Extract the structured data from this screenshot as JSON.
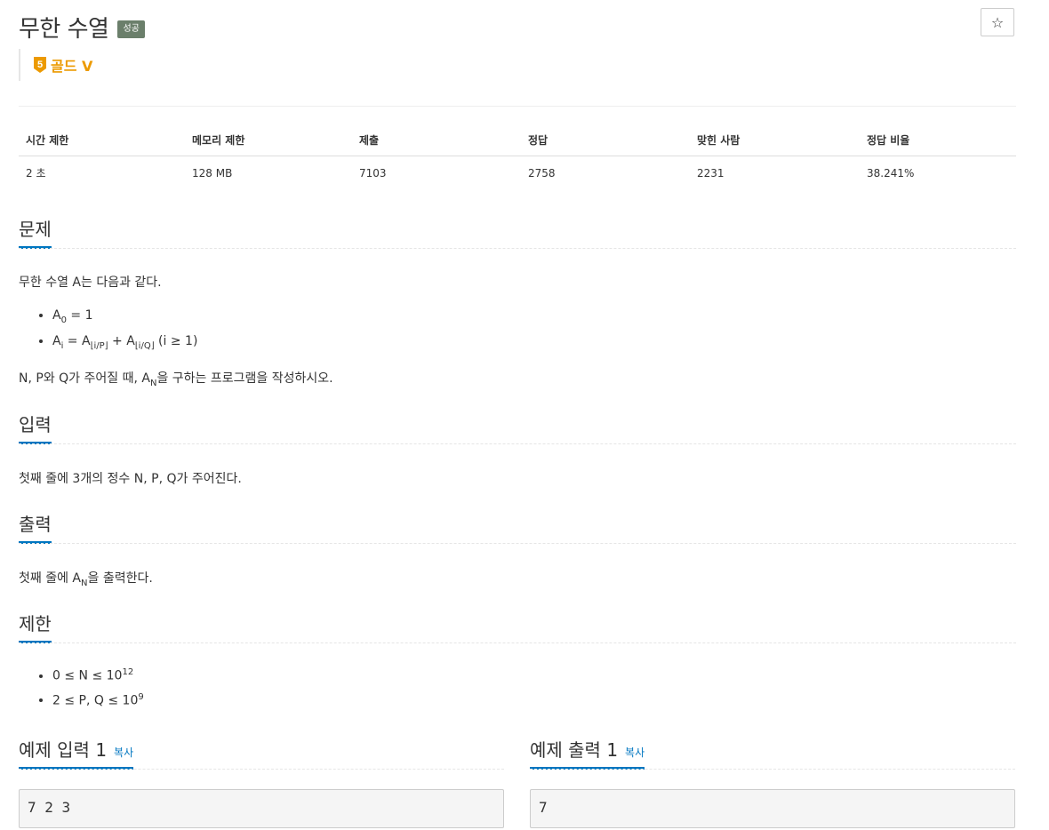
{
  "problem": {
    "title": "무한 수열",
    "status_badge": "성공",
    "tier_number": "5",
    "tier": "골드 V",
    "star": "☆"
  },
  "info_table": {
    "headers": [
      "시간 제한",
      "메모리 제한",
      "제출",
      "정답",
      "맞힌 사람",
      "정답 비율"
    ],
    "values": [
      "2 초",
      "128 MB",
      "7103",
      "2758",
      "2231",
      "38.241%"
    ]
  },
  "sections": {
    "description": {
      "heading": "문제",
      "intro": "무한 수열 A는 다음과 같다.",
      "seq_a": "A",
      "sub_0": "0",
      "eq_one": " = 1",
      "sub_i": "i",
      "eq_sign": " = A",
      "sub_ip": "⌊i/P⌋",
      "plus_a": " + A",
      "sub_iq": "⌊i/Q⌋",
      "cond": " (i ≥ 1)",
      "task_prefix": "N, P와 Q가 주어질 때, A",
      "sub_n": "N",
      "task_suffix": "을 구하는 프로그램을 작성하시오."
    },
    "input": {
      "heading": "입력",
      "text": "첫째 줄에 3개의 정수 N, P, Q가 주어진다."
    },
    "output": {
      "heading": "출력",
      "prefix": "첫째 줄에 A",
      "sub": "N",
      "suffix": "을 출력한다."
    },
    "limits": {
      "heading": "제한",
      "l1_text": "0 ≤ N ≤ 10",
      "l1_sup": "12",
      "l2_text": "2 ≤ P, Q ≤ 10",
      "l2_sup": "9"
    }
  },
  "samples": {
    "input_heading": "예제 입력 1",
    "output_heading": "예제 출력 1",
    "copy_label": "복사",
    "input_value": "7 2 3",
    "output_value": "7"
  }
}
